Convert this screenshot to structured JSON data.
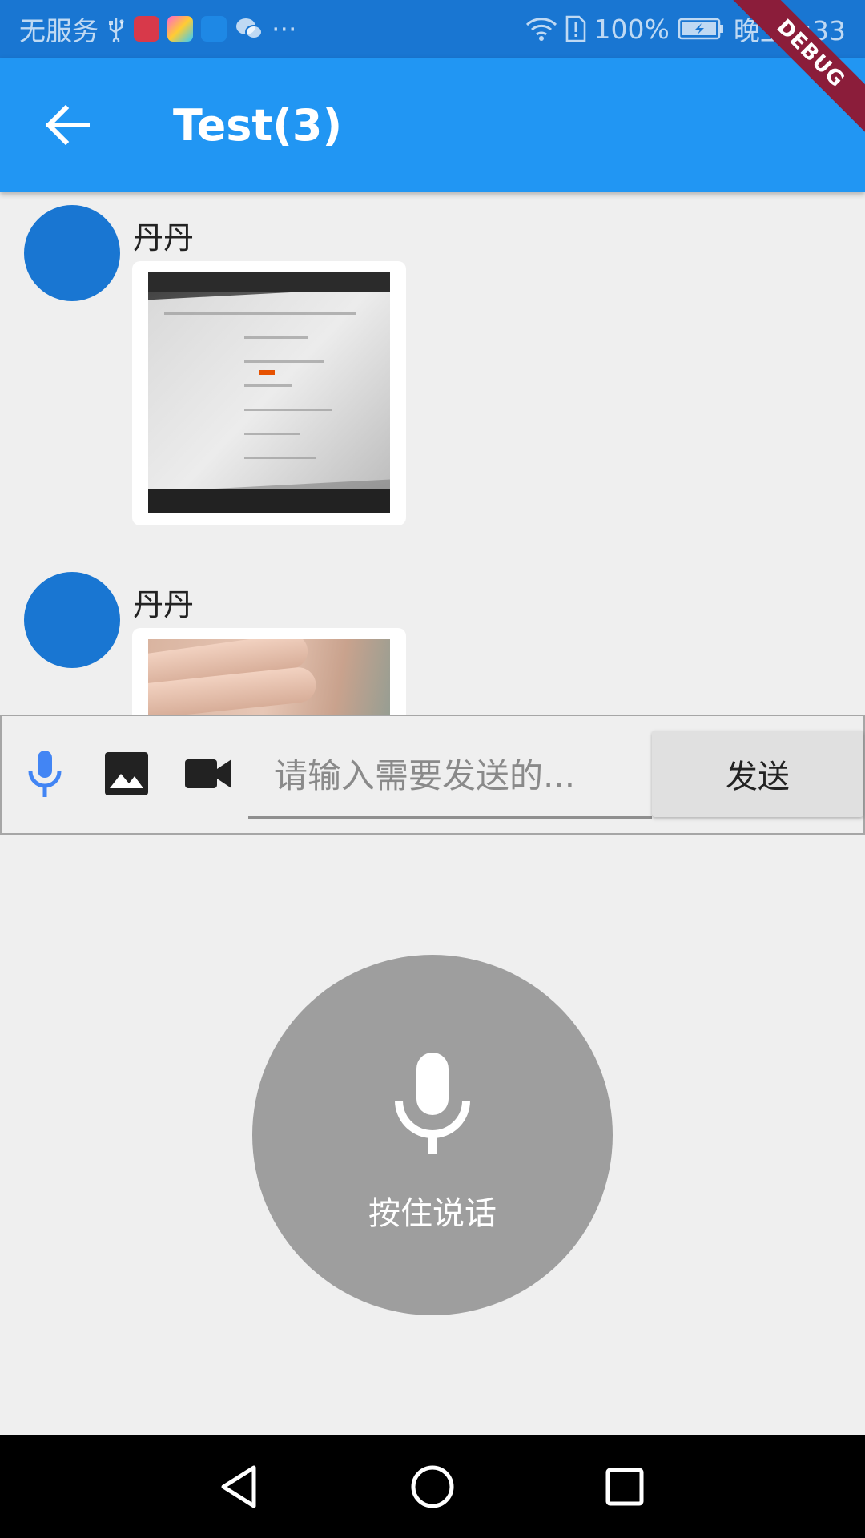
{
  "status_bar": {
    "carrier": "无服务",
    "more": "···",
    "battery": "100%",
    "time": "晚上8:33"
  },
  "debug_banner": "DEBUG",
  "app_bar": {
    "title": "Test(3)"
  },
  "messages": [
    {
      "sender": "丹丹"
    },
    {
      "sender": "丹丹"
    }
  ],
  "input_bar": {
    "placeholder": "请输入需要发送的...",
    "send_label": "发送"
  },
  "record": {
    "label": "按住说话"
  },
  "colors": {
    "status_bar": "#1976d2",
    "app_bar": "#2196f3",
    "avatar": "#1976d2",
    "background": "#efefef",
    "record_button": "#9e9e9e",
    "mic_icon": "#4285f4"
  }
}
